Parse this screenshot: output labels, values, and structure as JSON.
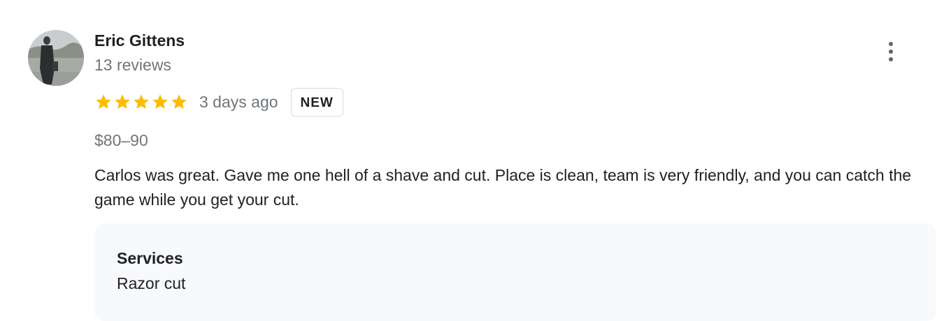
{
  "review": {
    "reviewer_name": "Eric Gittens",
    "review_count": "13 reviews",
    "rating": 5,
    "rating_max": 5,
    "date": "3 days ago",
    "badge": "NEW",
    "price": "$80–90",
    "text": "Carlos was great. Gave me one hell of a shave and cut. Place is clean, team is very friendly, and you can catch the game while you get your cut.",
    "services": {
      "label": "Services",
      "value": "Razor cut"
    }
  },
  "icons": {
    "avatar": "reviewer-photo",
    "menu": "more-vert-icon",
    "star": "star-icon"
  },
  "colors": {
    "star": "#fbbc04",
    "secondary_text": "#70757a",
    "primary_text": "#202124",
    "services_background": "#f8f9fa",
    "badge_border": "#dadce0"
  }
}
